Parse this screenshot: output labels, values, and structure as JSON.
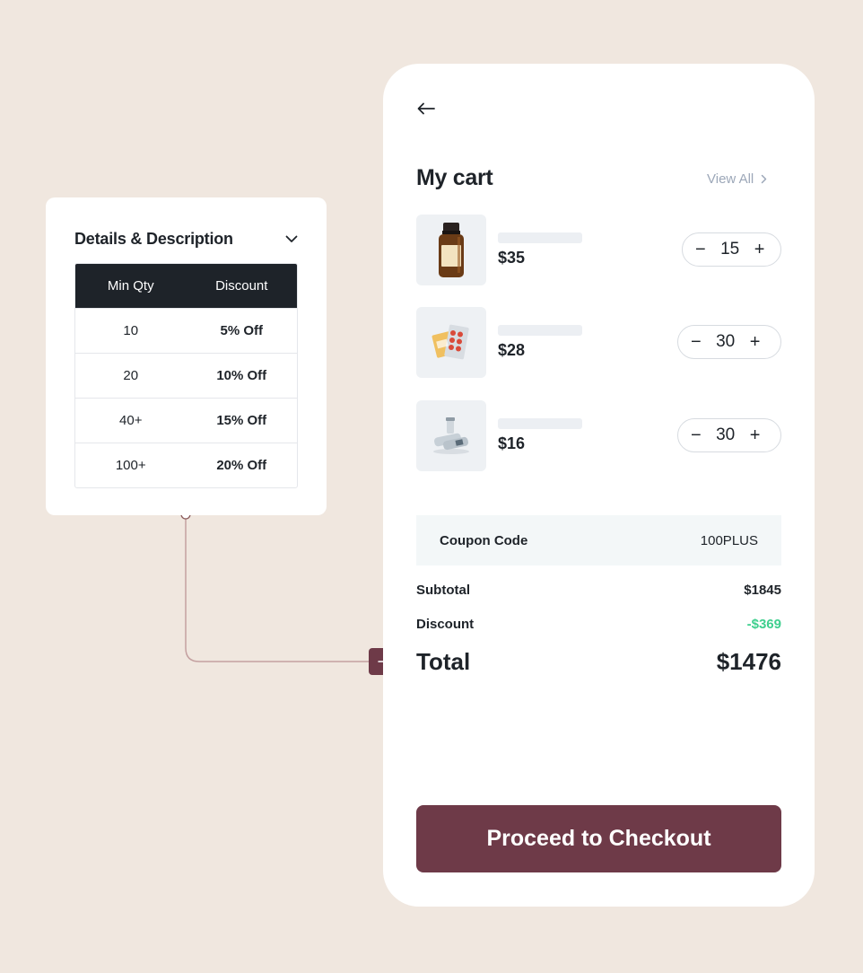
{
  "details": {
    "title": "Details & Description",
    "columns": [
      "Min Qty",
      "Discount"
    ],
    "rows": [
      {
        "min_qty": "10",
        "discount": "5% Off"
      },
      {
        "min_qty": "20",
        "discount": "10% Off"
      },
      {
        "min_qty": "40+",
        "discount": "15% Off"
      },
      {
        "min_qty": "100+",
        "discount": "20% Off"
      }
    ]
  },
  "cart": {
    "title": "My cart",
    "view_all": "View All",
    "items": [
      {
        "price": "$35",
        "qty": "15",
        "image": "medicine-bottle"
      },
      {
        "price": "$28",
        "qty": "30",
        "image": "pill-blister-pack"
      },
      {
        "price": "$16",
        "qty": "30",
        "image": "vials"
      }
    ],
    "coupon": {
      "label": "Coupon Code",
      "value": "100PLUS"
    },
    "subtotal": {
      "label": "Subtotal",
      "value": "$1845"
    },
    "discount": {
      "label": "Discount",
      "value": "-$369"
    },
    "total": {
      "label": "Total",
      "value": "$1476"
    },
    "checkout_label": "Proceed to Checkout"
  },
  "colors": {
    "background": "#f0e7df",
    "accent": "#6e3a48",
    "dark": "#1e2329",
    "discount_green": "#3ecf8e"
  }
}
